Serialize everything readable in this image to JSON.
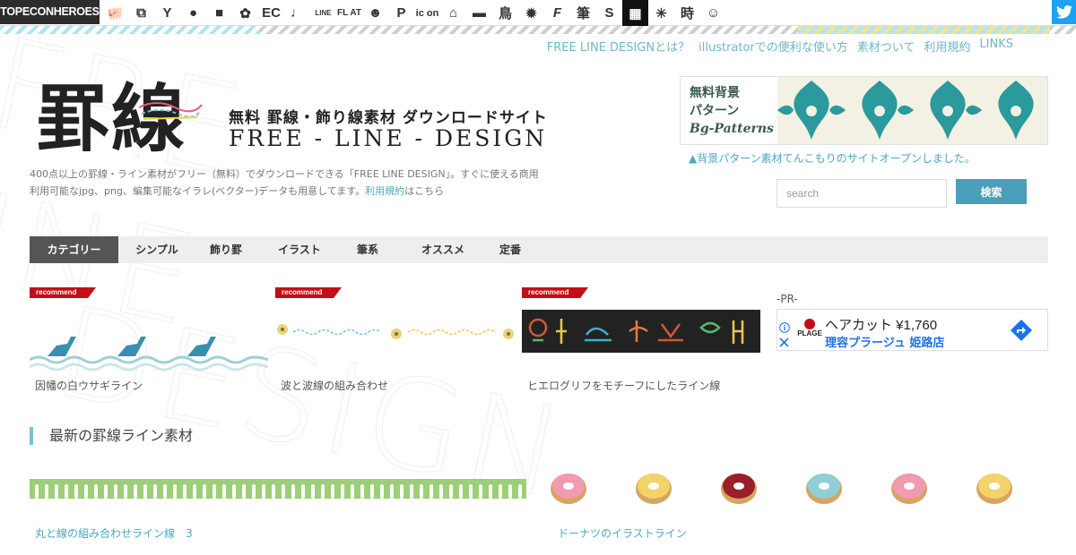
{
  "topbar": {
    "brand": "TOPECONHEROES",
    "icons": [
      {
        "name": "pig-icon",
        "glyph": "🐖"
      },
      {
        "name": "copy-icon",
        "glyph": "⧉"
      },
      {
        "name": "person-icon",
        "glyph": "Y"
      },
      {
        "name": "speech-bubble-icon",
        "glyph": "●"
      },
      {
        "name": "tag-icon",
        "glyph": "■"
      },
      {
        "name": "flower-icon",
        "glyph": "✿"
      },
      {
        "name": "ec-icon",
        "glyph": "EC"
      },
      {
        "name": "music-note-icon",
        "glyph": "♩"
      },
      {
        "name": "line-icon",
        "glyph": "LINE"
      },
      {
        "name": "flat-icon",
        "glyph": "FL AT"
      },
      {
        "name": "smiley-icon",
        "glyph": "☻"
      },
      {
        "name": "parking-icon",
        "glyph": "P"
      },
      {
        "name": "icon-text-icon",
        "glyph": "ic on"
      },
      {
        "name": "house-icon",
        "glyph": "⌂"
      },
      {
        "name": "bed-icon",
        "glyph": "▬"
      },
      {
        "name": "bird-icon",
        "glyph": "鳥"
      },
      {
        "name": "gear-shape-icon",
        "glyph": "✹"
      },
      {
        "name": "f-letter-icon",
        "glyph": "F"
      },
      {
        "name": "brush-icon",
        "glyph": "筆"
      },
      {
        "name": "s-letter-icon",
        "glyph": "S"
      },
      {
        "name": "grid-icon",
        "glyph": "▦"
      },
      {
        "name": "burst-icon",
        "glyph": "✳"
      },
      {
        "name": "clock-kanji-icon",
        "glyph": "時"
      },
      {
        "name": "face-icon",
        "glyph": "☺"
      }
    ],
    "twitter_icon": "twitter-icon"
  },
  "nav_links": [
    "FREE LINE DESIGNとは？",
    "illustratorでの便利な使い方",
    "素材ついて",
    "利用規約",
    "LINKS"
  ],
  "logo": {
    "kanji": "罫線",
    "subtitle": "無料 罫線・飾り線素材 ダウンロードサイト",
    "english": "FREE - LINE - DESIGN"
  },
  "description": {
    "text": "400点以上の罫線・ライン素材がフリー（無料）でダウンロードできる「FREE LINE DESIGN」。すぐに使える商用利用可能なjpg、png、編集可能なイラレ(ベクター)データも用意してます。",
    "link": "利用規約",
    "link_after": "はこちら"
  },
  "banner": {
    "line1": "無料背景",
    "line2": "パターン",
    "line3": "Bg-Patterns",
    "note": "▲背景パターン素材てんこもりのサイトオープンしました。",
    "pattern_color": "#2a9a9c"
  },
  "search": {
    "placeholder": "search",
    "button": "検索"
  },
  "categories": [
    "カテゴリー",
    "シンプル",
    "飾り罫",
    "イラスト",
    "筆系",
    "オススメ",
    "定番"
  ],
  "recommend_label": "recommend",
  "recommend_cards": [
    {
      "title": "因幡の白ウサギライン"
    },
    {
      "title": "波と波線の組み合わせ"
    },
    {
      "title": "ヒエログリフをモチーフにしたライン線"
    }
  ],
  "pr": {
    "label": "-PR-",
    "ad_title": "ヘアカット ¥1,760",
    "ad_sub": "理容プラージュ 姫路店",
    "ad_brand": "PLAGE"
  },
  "section_heading": "最新の罫線ライン素材",
  "latest": [
    {
      "title": "丸と線の組み合わせライン線　3"
    },
    {
      "title": "ドーナツのイラストライン"
    }
  ],
  "background_word": "FREE LINE DESIGN",
  "colors": {
    "accent": "#4aa9c1",
    "active_tab": "#555555",
    "recommend": "#c40d14",
    "twitter": "#1da1f2"
  }
}
